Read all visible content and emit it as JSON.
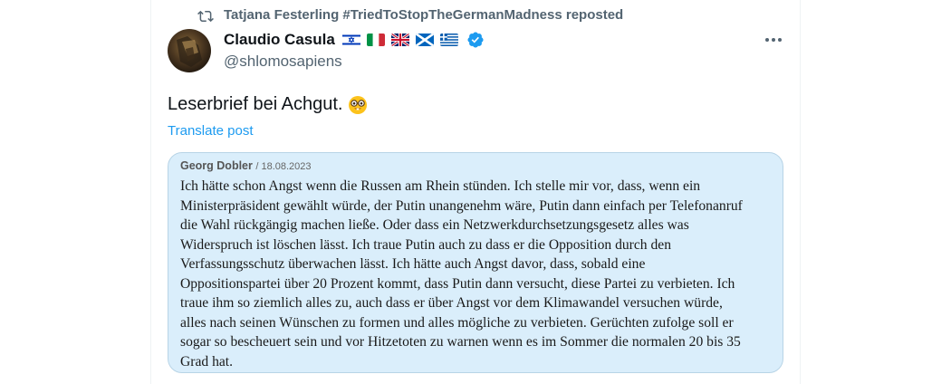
{
  "repost": {
    "icon": "repost-icon",
    "text": "Tatjana Festerling #TriedToStopTheGermanMadness reposted"
  },
  "author": {
    "display_name": "Claudio Casula",
    "flags": [
      "israel-flag-icon",
      "italy-flag-icon",
      "uk-flag-icon",
      "scotland-flag-icon",
      "greece-flag-icon"
    ],
    "verified": "verified-badge-icon",
    "handle": "@shlomosapiens"
  },
  "more_icon": "more-options-icon",
  "post": {
    "text": "Leserbrief bei Achgut.",
    "emoji": "nerd-face-emoji",
    "translate_label": "Translate post"
  },
  "letter": {
    "author": "Georg Dobler",
    "date": "/ 18.08.2023",
    "lines": [
      "Ich hätte schon Angst wenn die Russen am Rhein stünden. Ich stelle mir vor, dass, wenn ein",
      "Ministerpräsident gewählt würde, der Putin unangenehm wäre, Putin dann einfach per Telefonanruf",
      "die Wahl rückgängig machen ließe. Oder dass ein Netzwerkdurchsetzungsgesetz alles was",
      "Widerspruch ist löschen lässt. Ich traue Putin auch zu dass er die Opposition durch den",
      "Verfassungsschutz überwachen lässt. Ich hätte auch Angst davor, dass, sobald eine",
      "Oppositionspartei über 20 Prozent kommt, dass Putin dann versucht, diese Partei zu verbieten. Ich",
      "traue ihm so ziemlich alles zu, auch dass er über Angst vor dem Klimawandel versuchen würde,",
      "alles nach seinen Wünschen zu formen und alles mögliche zu verbieten. Gerüchten zufolge soll er",
      "sogar so bescheuert sein und vor Hitzetoten zu warnen wenn es im Sommer die normalen 20 bis 35",
      "Grad hat."
    ]
  },
  "colors": {
    "accent": "#1d9bf0",
    "secondary_text": "#536471",
    "card_background": "#daeefb"
  }
}
